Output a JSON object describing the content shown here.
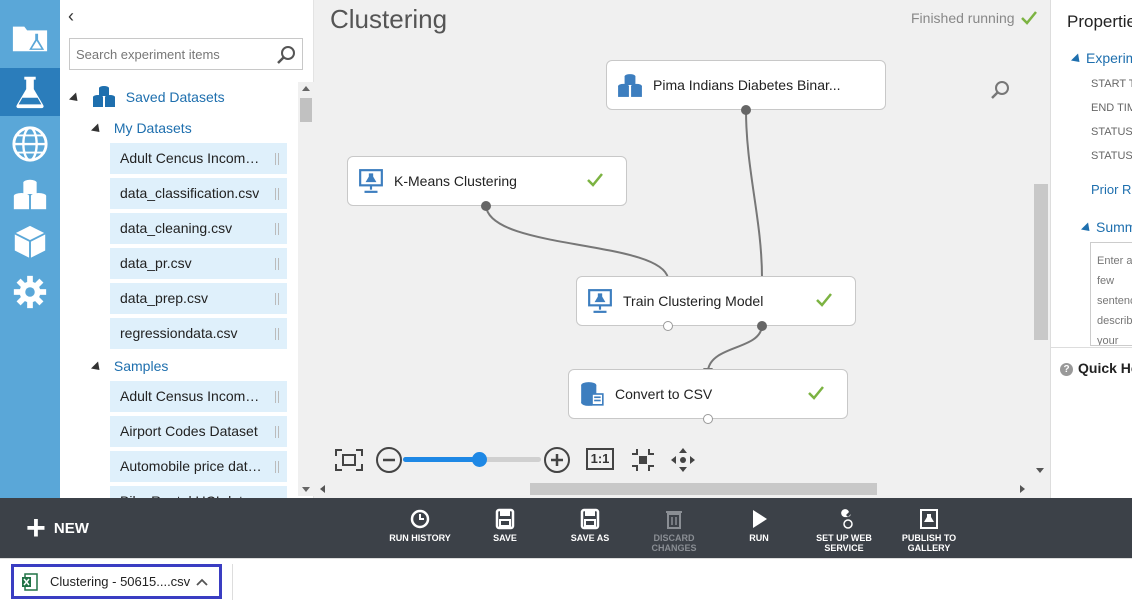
{
  "nav": {
    "items": [
      {
        "name": "projects-icon",
        "active": false
      },
      {
        "name": "experiments-icon",
        "active": true
      },
      {
        "name": "web-services-icon",
        "active": false
      },
      {
        "name": "datasets-icon",
        "active": false
      },
      {
        "name": "trained-models-icon",
        "active": false
      },
      {
        "name": "settings-icon",
        "active": false
      }
    ]
  },
  "palette": {
    "search_placeholder": "Search experiment items",
    "saved_datasets": "Saved Datasets",
    "my_datasets": "My Datasets",
    "my_items": [
      "Adult Cencus Income Binary",
      "data_classification.csv",
      "data_cleaning.csv",
      "data_pr.csv",
      "data_prep.csv",
      "regressiondata.csv"
    ],
    "samples": "Samples",
    "sample_items": [
      "Adult Census Income Binary",
      "Airport Codes Dataset",
      "Automobile price data (Raw)",
      "Bike Rental UCI dataset"
    ]
  },
  "canvas": {
    "title": "Clustering",
    "status": "Finished running",
    "modules": {
      "pima": "Pima Indians Diabetes Binar...",
      "kmeans": "K-Means Clustering",
      "train": "Train Clustering Model",
      "convert": "Convert to CSV"
    },
    "zoom": {
      "level": 0.55,
      "ratio_label": "1:1"
    }
  },
  "properties": {
    "title": "Properties",
    "experiment_section": "Experiment",
    "fields": [
      "START TIME",
      "END TIME",
      "STATUS CODE",
      "STATUS DETAILS"
    ],
    "prior_runs": "Prior Run",
    "summary_section": "Summary",
    "summary_placeholder": "Enter a few sentences describing your experiment",
    "quick_help": "Quick Help"
  },
  "commands": {
    "new": "NEW",
    "run_history": "RUN HISTORY",
    "save": "SAVE",
    "save_as": "SAVE AS",
    "discard": "DISCARD CHANGES",
    "run": "RUN",
    "setup_ws_line1": "SET UP WEB",
    "setup_ws_line2": "SERVICE",
    "publish_line1": "PUBLISH TO",
    "publish_line2": "GALLERY"
  },
  "download": {
    "filename": "Clustering - 50615....csv"
  },
  "colors": {
    "rail": "#5aa7d8",
    "rail_active": "#2b7dbb",
    "accent": "#1e6fae",
    "check": "#7cb342",
    "cmdbar": "#3c4148",
    "download_highlight": "#3a3dc2"
  }
}
